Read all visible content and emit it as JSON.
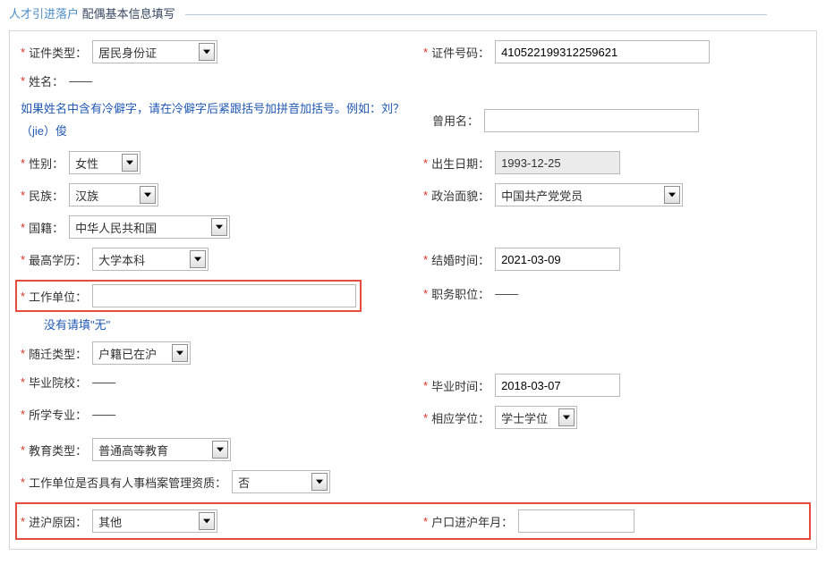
{
  "section": {
    "part1": "人才引进落户",
    "part2": "配偶基本信息填写"
  },
  "left": {
    "idType": {
      "label": "证件类型：",
      "value": "居民身份证"
    },
    "name": {
      "label": "姓名：",
      "value": "——"
    },
    "nameHint": "如果姓名中含有冷僻字，请在冷僻字后紧跟括号加拼音加括号。例如：刘？（jie）俊",
    "gender": {
      "label": "性别：",
      "value": "女性"
    },
    "ethnicity": {
      "label": "民族：",
      "value": "汉族"
    },
    "nationality": {
      "label": "国籍：",
      "value": "中华人民共和国"
    },
    "education": {
      "label": "最高学历：",
      "value": "大学本科"
    },
    "workUnit": {
      "label": "工作单位：",
      "value": ""
    },
    "workUnitHint": "没有请填\"无\"",
    "followType": {
      "label": "随迁类型：",
      "value": "户籍已在沪"
    },
    "school": {
      "label": "毕业院校：",
      "value": "——"
    },
    "major": {
      "label": "所学专业：",
      "value": "——"
    },
    "eduType": {
      "label": "教育类型：",
      "value": "普通高等教育"
    },
    "personnelFile": {
      "label": "工作单位是否具有人事档案管理资质：",
      "value": "否"
    }
  },
  "right": {
    "idNumber": {
      "label": "证件号码：",
      "value": "410522199312259621"
    },
    "formerName": {
      "label": "曾用名：",
      "value": ""
    },
    "birthDate": {
      "label": "出生日期：",
      "value": "1993-12-25"
    },
    "political": {
      "label": "政治面貌：",
      "value": "中国共产党党员"
    },
    "marriageDate": {
      "label": "结婚时间：",
      "value": "2021-03-09"
    },
    "position": {
      "label": "职务职位：",
      "value": "——"
    },
    "gradDate": {
      "label": "毕业时间：",
      "value": "2018-03-07"
    },
    "degree": {
      "label": "相应学位：",
      "value": "学士学位"
    }
  },
  "bottom": {
    "reason": {
      "label": "进沪原因：",
      "value": "其他"
    },
    "enterDate": {
      "label": "户口进沪年月：",
      "value": ""
    }
  }
}
